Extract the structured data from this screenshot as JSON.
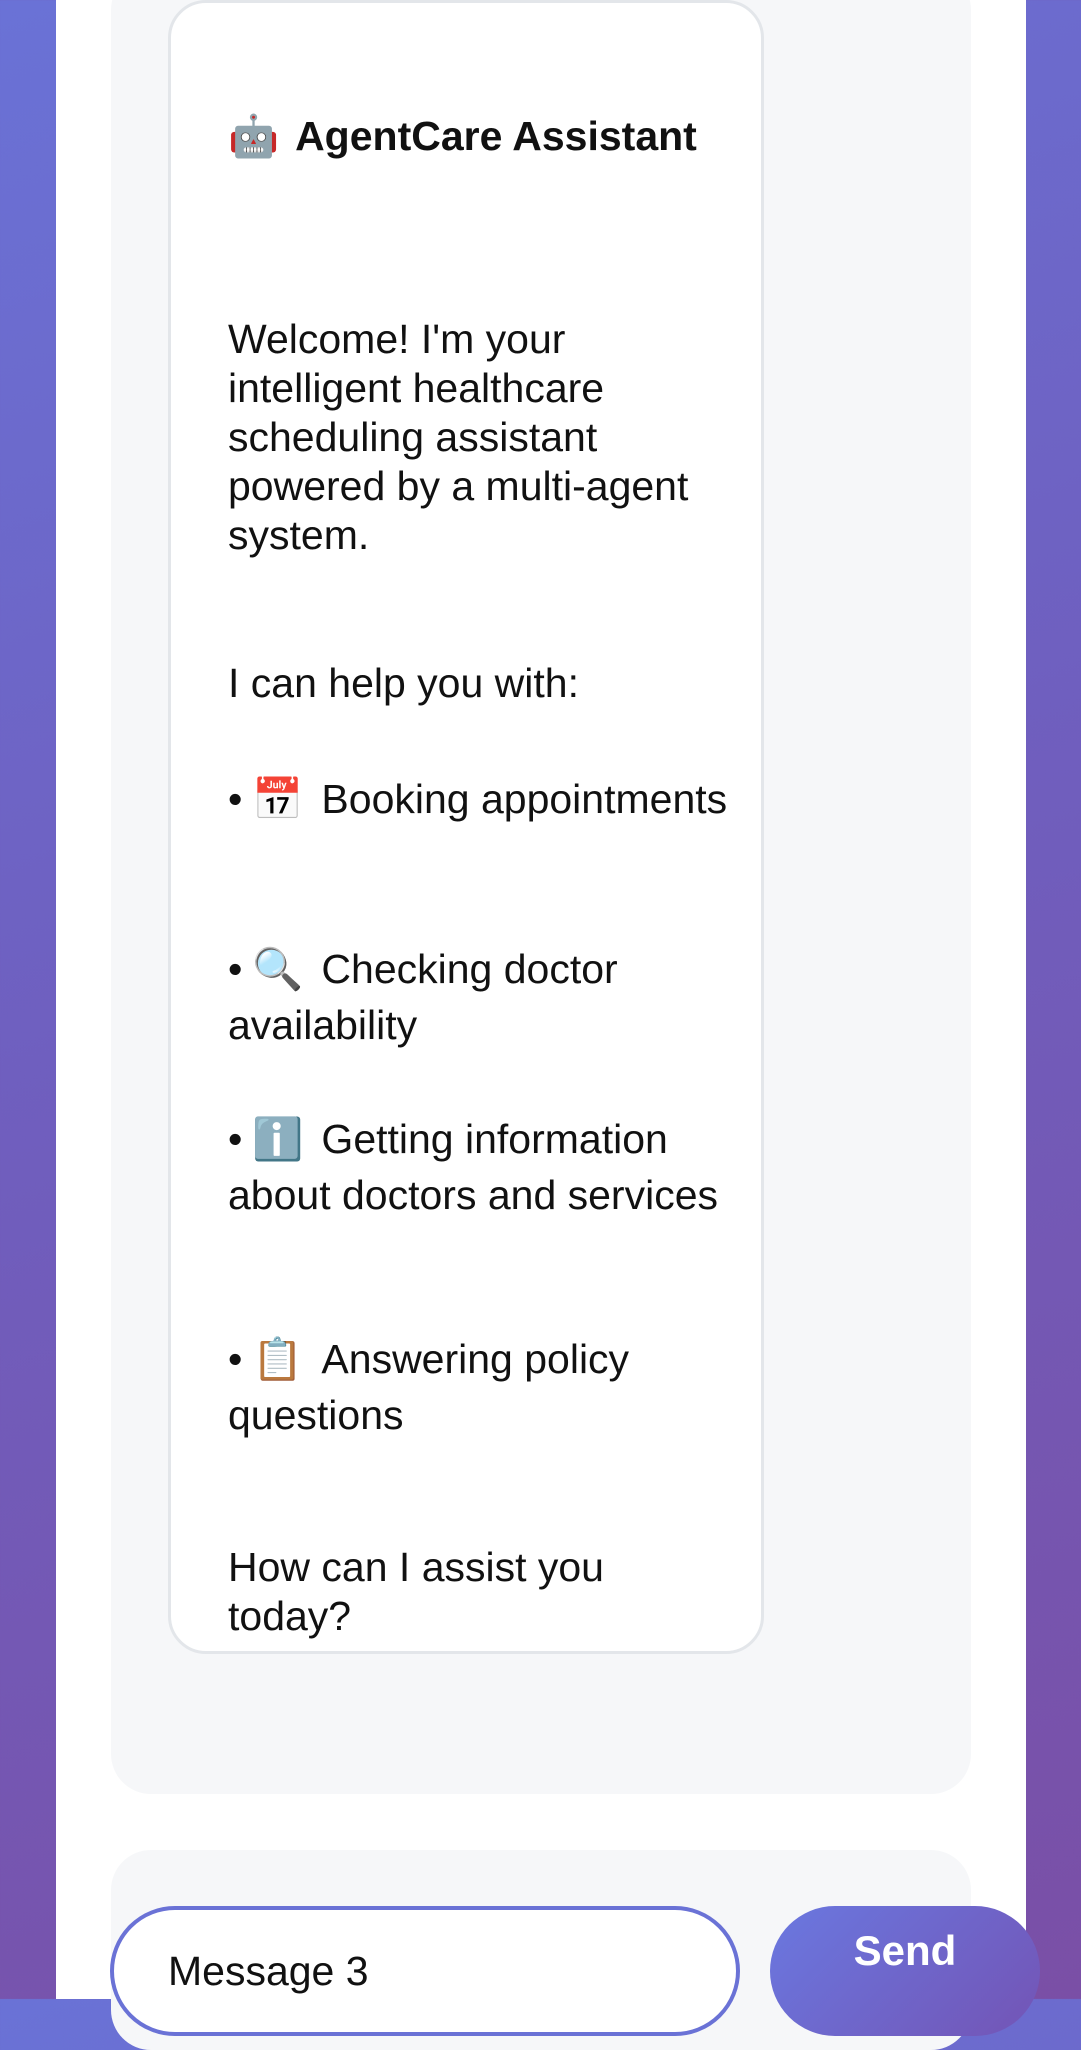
{
  "assistant_message": {
    "avatar_icon": "robot-icon",
    "avatar_emoji": "🤖",
    "title": "AgentCare Assistant",
    "welcome": "Welcome! I'm your intelligent healthcare scheduling assistant powered by a multi-agent system.",
    "intro": "I can help you with:",
    "bullets": [
      {
        "icon": "calendar-icon",
        "emoji": "📅",
        "text": "Booking appointments"
      },
      {
        "icon": "magnifier-icon",
        "emoji": "🔍",
        "text": "Checking doctor availability"
      },
      {
        "icon": "info-icon",
        "emoji": "ℹ️",
        "text": "Getting information about doctors and services"
      },
      {
        "icon": "clipboard-icon",
        "emoji": "📋",
        "text": "Answering policy questions"
      }
    ],
    "closing": "How can I assist you today?"
  },
  "composer": {
    "input_value": "Message 3",
    "send_label": "Send"
  },
  "colors": {
    "accent": "#6a72d6",
    "bubble_border": "#e3e6ea",
    "chat_background": "#f6f7f9"
  }
}
